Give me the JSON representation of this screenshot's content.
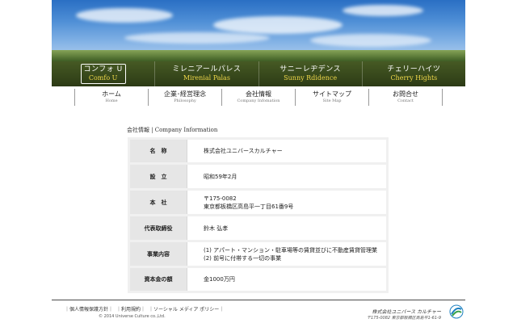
{
  "properties": [
    {
      "jp": "コンフォ U",
      "en": "Comfo U"
    },
    {
      "jp": "ミレニアールパレス",
      "en": "Mirenial Palas"
    },
    {
      "jp": "サニーレヂデンス",
      "en": "Sunny Rdidence"
    },
    {
      "jp": "チェリーハイツ",
      "en": "Cherry Hights"
    }
  ],
  "nav": [
    {
      "jp": "ホーム",
      "en": "Home"
    },
    {
      "jp": "企業･経営理念",
      "en": "Philosophy"
    },
    {
      "jp": "会社情報",
      "en": "Company Infomation"
    },
    {
      "jp": "サイトマップ",
      "en": "Site Map"
    },
    {
      "jp": "お問合せ",
      "en": "Contact"
    }
  ],
  "content": {
    "heading": "会社情報 | Company Information",
    "rows": [
      {
        "label": "名　称",
        "value": [
          "株式会社ユニバースカルチャー"
        ]
      },
      {
        "label": "設　立",
        "value": [
          "昭和59年2月"
        ]
      },
      {
        "label": "本　社",
        "value": [
          "〒175-0082",
          "東京都板橋区高島平一丁目61番9号"
        ]
      },
      {
        "label": "代表取締役",
        "value": [
          "鈴木 弘孝"
        ]
      },
      {
        "label": "事業内容",
        "value": [
          "(1) アパート・マンション・駐車場等の賃貸並びに不動産賃貸管理業",
          "(2) 前号に付帯する一切の事業"
        ]
      },
      {
        "label": "資本金の額",
        "value": [
          "金1000万円"
        ]
      }
    ]
  },
  "footer": {
    "links": [
      "｜個人情報保護方針｜",
      "｜利用規約｜",
      "｜ソーシャル メディア ポリシー｜"
    ],
    "copyright": "© 2014 Universe Culture co.,Ltd.",
    "company": "株式会社ユニバース カルチャー",
    "address": "〒175-0082 東京都板橋区高島平1-61-9"
  }
}
